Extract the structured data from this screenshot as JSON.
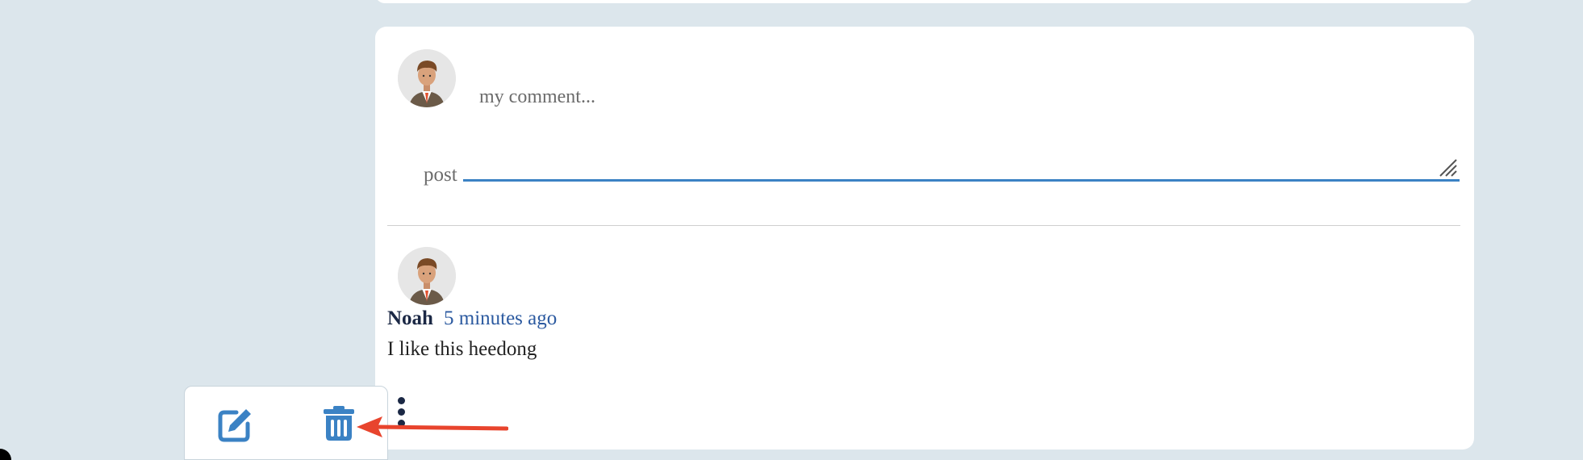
{
  "composer": {
    "placeholder": "my comment...",
    "post_label": "post"
  },
  "comment": {
    "author": "Noah",
    "timestamp": "5 minutes ago",
    "text": "I like this heedong"
  },
  "menu": {
    "edit_icon": "edit-icon",
    "delete_icon": "trash-icon"
  },
  "colors": {
    "background": "#dce6ec",
    "accent": "#3b82c4",
    "author": "#1b2845",
    "timestamp": "#2c5aa0",
    "annotation_arrow": "#e8442d"
  }
}
